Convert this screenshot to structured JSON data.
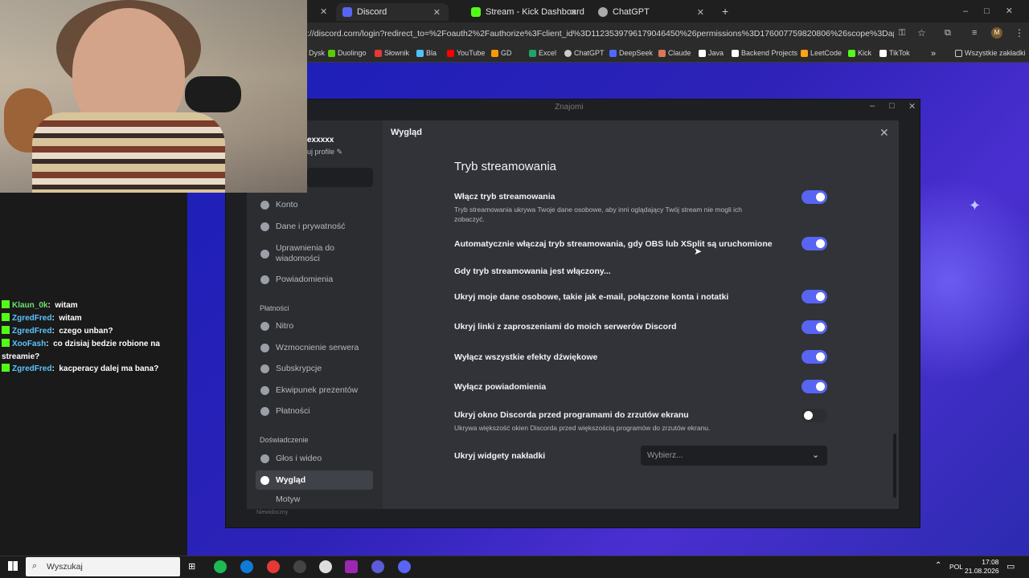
{
  "browser": {
    "tabs": [
      {
        "label": "Discord",
        "color": "#5865f2",
        "active": true
      },
      {
        "label": "Stream - Kick Dashboard",
        "color": "#53fc18",
        "active": false
      },
      {
        "label": "ChatGPT",
        "color": "#aaaaaa",
        "active": false
      }
    ],
    "new_tab": "+",
    "url": "://discord.com/login?redirect_to=%2Foauth2%2Fauthorize%3Fclient_id%3D1123539796179046450%26permissions%3D176007759820806%26scope%3Dapplications.commands...",
    "bookmarks": [
      {
        "label": "Dysk",
        "color": "#34a853"
      },
      {
        "label": "Duolingo",
        "color": "#58cc02"
      },
      {
        "label": "Słownik",
        "color": "#e53935"
      },
      {
        "label": "Bla",
        "color": "#4fc3f7"
      },
      {
        "label": "YouTube",
        "color": "#ff0000"
      },
      {
        "label": "GD",
        "color": "#ff9800"
      },
      {
        "label": "Excel",
        "color": "#21a366"
      },
      {
        "label": "ChatGPT",
        "color": "#cccccc"
      },
      {
        "label": "DeepSeek",
        "color": "#4d6bfe"
      },
      {
        "label": "Claude",
        "color": "#d97757"
      },
      {
        "label": "Java",
        "color": "#ffffff"
      },
      {
        "label": "Backend Projects",
        "color": "#ffffff"
      },
      {
        "label": "LeetCode",
        "color": "#ffa116"
      },
      {
        "label": "Kick",
        "color": "#53fc18"
      },
      {
        "label": "TikTok",
        "color": "#ffffff"
      }
    ],
    "all_bookmarks": "Wszystkie zakładki",
    "more": "»"
  },
  "discord": {
    "window_title": "Znajomi",
    "username_partial": "exxxxx",
    "edit_profile_partial": "uj profile",
    "modal_header": "Wygląd",
    "sidebar": {
      "items_top": [
        {
          "label": "Konto"
        },
        {
          "label": "Dane i prywatność"
        },
        {
          "label": "Uprawnienia do wiadomości"
        },
        {
          "label": "Powiadomienia"
        }
      ],
      "section_payments": "Płatności",
      "items_payments": [
        {
          "label": "Nitro"
        },
        {
          "label": "Wzmocnienie serwera"
        },
        {
          "label": "Subskrypcje"
        },
        {
          "label": "Ekwipunek prezentów"
        },
        {
          "label": "Płatności"
        }
      ],
      "section_experience": "Doświadczenie",
      "items_experience": [
        {
          "label": "Głos i wideo"
        },
        {
          "label": "Wygląd"
        },
        {
          "label": "Motyw"
        }
      ],
      "status_partial": "Niewidoczny"
    },
    "content": {
      "title": "Tryb streamowania",
      "enable_label": "Włącz tryb streamowania",
      "enable_desc": "Tryb streamowania ukrywa Twoje dane osobowe, aby inni oglądający Twój stream nie mogli ich zobaczyć.",
      "auto_label": "Automatycznie włączaj tryb streamowania, gdy OBS lub XSplit są uruchomione",
      "when_header": "Gdy tryb streamowania jest włączony...",
      "hide_personal": "Ukryj moje dane osobowe, takie jak e-mail, połączone konta i notatki",
      "hide_links": "Ukryj linki z zaproszeniami do moich serwerów Discord",
      "disable_sounds": "Wyłącz wszystkie efekty dźwiękowe",
      "disable_notifs": "Wyłącz powiadomienia",
      "hide_window_label": "Ukryj okno Discorda przed programami do zrzutów ekranu",
      "hide_window_desc": "Ukrywa większość okien Discorda przed większością programów do zrzutów ekranu.",
      "hide_widgets_label": "Ukryj widgety nakładki",
      "select_placeholder": "Wybierz..."
    },
    "toggles": {
      "enable": true,
      "auto": true,
      "hide_personal": true,
      "hide_links": true,
      "disable_sounds": true,
      "disable_notifs": true,
      "hide_window": false
    },
    "accent": "#5865f2"
  },
  "chat": [
    {
      "user": "Klaun_0k",
      "msg": "witam",
      "color": "u1"
    },
    {
      "user": "ZgredFred",
      "msg": "witam",
      "color": "u2"
    },
    {
      "user": "ZgredFred",
      "msg": "czego unban?",
      "color": "u2"
    },
    {
      "user": "XooFash",
      "msg": "co dzisiaj bedzie robione na streamie?",
      "color": "u2"
    },
    {
      "user": "ZgredFred",
      "msg": "kacperacy dalej ma bana?",
      "color": "u2"
    }
  ],
  "taskbar": {
    "search": "Wyszukaj",
    "lang": "POL",
    "time": "17:08",
    "date": "21.08.2026"
  }
}
